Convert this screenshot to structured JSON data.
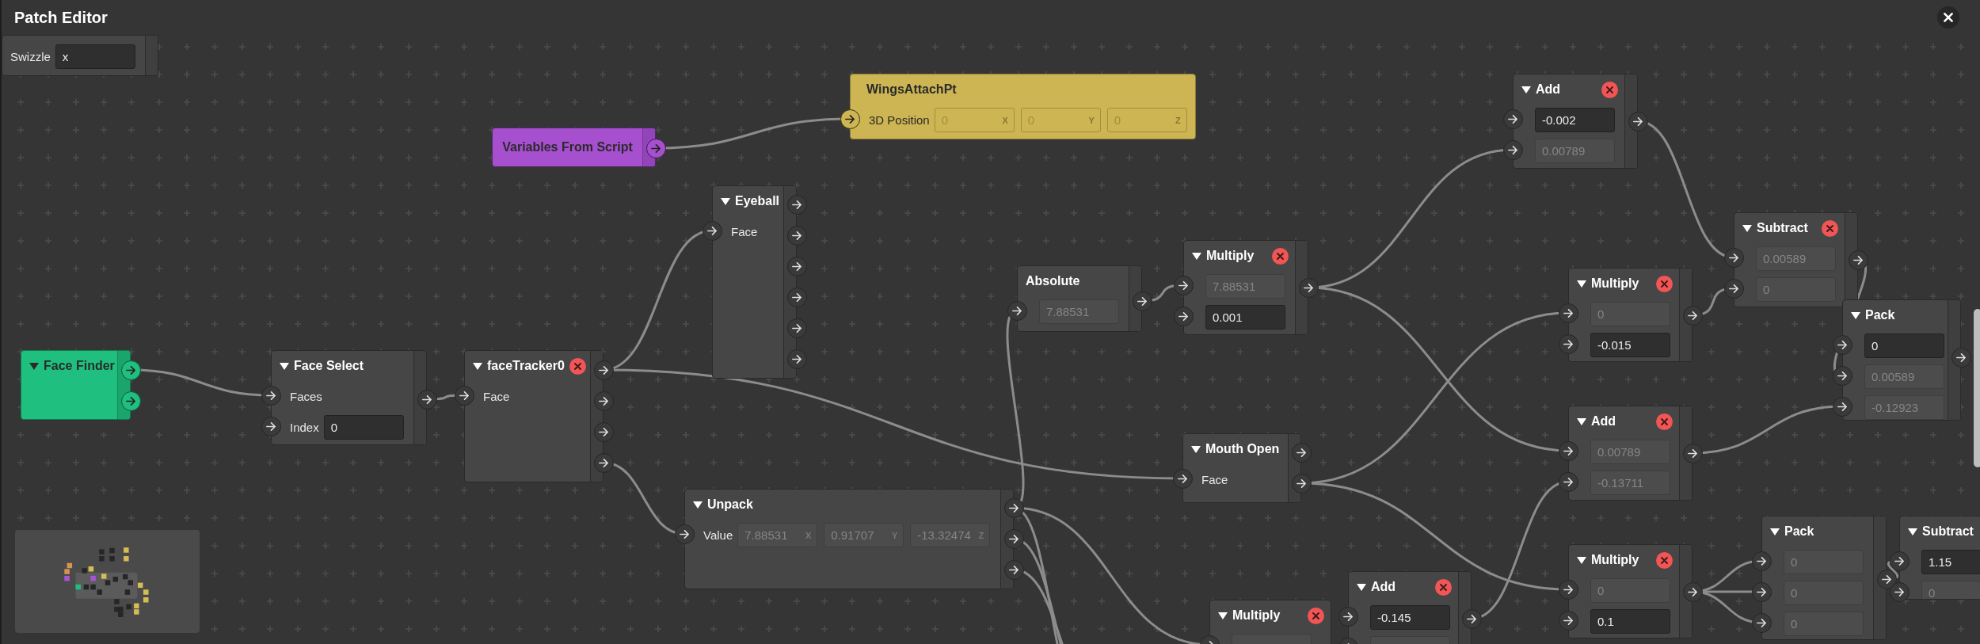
{
  "window": {
    "title": "Patch Editor"
  },
  "nodes": [
    {
      "kind": "patch",
      "rows": [
        {
          "label": "Swizzle",
          "has_port": false,
          "fields": [
            {
              "value": "x",
              "disabled": false
            }
          ]
        }
      ]
    },
    {
      "kind": "script",
      "title": "Variables From Script",
      "outputs": [
        {
          "kind": "arrow"
        }
      ]
    },
    {
      "kind": "object",
      "title": "WingsAttachPt",
      "rows": [
        {
          "label": "3D Position",
          "has_port": true,
          "fields": [
            {
              "value": "0",
              "axis": "X",
              "disabled": true
            },
            {
              "value": "0",
              "axis": "Y",
              "disabled": true
            },
            {
              "value": "0",
              "axis": "Z",
              "disabled": true
            }
          ]
        }
      ]
    },
    {
      "kind": "patch",
      "title": "Add",
      "expanded": true,
      "removable": true,
      "rows": [
        {
          "has_port": true,
          "fields": [
            {
              "value": "-0.002",
              "disabled": false
            }
          ]
        },
        {
          "has_port": true,
          "fields": [
            {
              "value": "0.00789",
              "disabled": true
            }
          ]
        }
      ],
      "outputs": [
        {
          "kind": "arrow"
        }
      ]
    },
    {
      "kind": "producer",
      "title": "Face Finder",
      "expanded": true,
      "outputs": [
        {
          "kind": "arrow"
        },
        {
          "kind": "arrow"
        }
      ]
    },
    {
      "kind": "patch",
      "title": "Face Select",
      "expanded": true,
      "rows": [
        {
          "label": "Faces",
          "has_port": true
        },
        {
          "label": "Index",
          "has_port": true,
          "fields": [
            {
              "value": "0",
              "disabled": false
            }
          ]
        }
      ],
      "outputs": [
        {
          "kind": "arrow"
        }
      ]
    },
    {
      "kind": "patch",
      "title": "faceTracker0",
      "expanded": true,
      "removable": true,
      "rows": [
        {
          "label": "Face",
          "has_port": true
        }
      ],
      "outputs": [
        {
          "kind": "arrow"
        },
        {
          "kind": "arrow"
        },
        {
          "kind": "arrow"
        },
        {
          "kind": "arrow"
        }
      ]
    },
    {
      "kind": "patch",
      "title": "Eyeball",
      "expanded": true,
      "rows": [
        {
          "label": "Face",
          "has_port": true
        }
      ],
      "outputs": [
        {
          "kind": "arrow"
        },
        {
          "kind": "arrow"
        },
        {
          "kind": "arrow"
        },
        {
          "kind": "arrow"
        },
        {
          "kind": "arrow"
        },
        {
          "kind": "arrow"
        }
      ]
    },
    {
      "kind": "patch",
      "title": "Absolute",
      "rows": [
        {
          "has_port": true,
          "fields": [
            {
              "value": "7.88531",
              "disabled": true
            }
          ]
        }
      ],
      "outputs": [
        {
          "kind": "arrow"
        }
      ]
    },
    {
      "kind": "patch",
      "title": "Multiply",
      "expanded": true,
      "removable": true,
      "rows": [
        {
          "has_port": true,
          "fields": [
            {
              "value": "7.88531",
              "disabled": true
            }
          ]
        },
        {
          "has_port": true,
          "fields": [
            {
              "value": "0.001",
              "disabled": false
            }
          ]
        }
      ],
      "outputs": [
        {
          "kind": "arrow"
        }
      ]
    },
    {
      "kind": "patch",
      "title": "Mouth Open",
      "expanded": true,
      "rows": [
        {
          "label": "Face",
          "has_port": true
        }
      ],
      "outputs": [
        {
          "kind": "arrow"
        },
        {
          "kind": "arrow"
        }
      ]
    },
    {
      "kind": "patch",
      "title": "Multiply",
      "expanded": true,
      "removable": true,
      "rows": [
        {
          "has_port": true,
          "fields": [
            {
              "value": "0",
              "disabled": true
            }
          ]
        },
        {
          "has_port": true,
          "fields": [
            {
              "value": "-0.015",
              "disabled": false
            }
          ]
        }
      ],
      "outputs": [
        {
          "kind": "arrow"
        }
      ]
    },
    {
      "kind": "patch",
      "title": "Add",
      "expanded": true,
      "removable": true,
      "rows": [
        {
          "has_port": true,
          "fields": [
            {
              "value": "0.00789",
              "disabled": true
            }
          ]
        },
        {
          "has_port": true,
          "fields": [
            {
              "value": "-0.13711",
              "disabled": true
            }
          ]
        }
      ],
      "outputs": [
        {
          "kind": "arrow"
        }
      ]
    },
    {
      "kind": "patch",
      "title": "Subtract",
      "expanded": true,
      "removable": true,
      "rows": [
        {
          "has_port": true,
          "fields": [
            {
              "value": "0.00589",
              "disabled": true
            }
          ]
        },
        {
          "has_port": true,
          "fields": [
            {
              "value": "0",
              "disabled": true
            }
          ]
        }
      ],
      "outputs": [
        {
          "kind": "arrow"
        }
      ]
    },
    {
      "kind": "patch",
      "title": "Pack",
      "expanded": true,
      "rows": [
        {
          "has_port": true,
          "fields": [
            {
              "value": "0",
              "disabled": false
            }
          ]
        },
        {
          "has_port": true,
          "fields": [
            {
              "value": "0.00589",
              "disabled": true
            }
          ]
        },
        {
          "has_port": true,
          "fields": [
            {
              "value": "-0.12923",
              "disabled": true
            }
          ]
        }
      ],
      "outputs": [
        {
          "kind": "arrow"
        }
      ]
    },
    {
      "kind": "patch",
      "title": "Unpack",
      "expanded": true,
      "rows": [
        {
          "label": "Value",
          "has_port": true,
          "fields": [
            {
              "value": "7.88531",
              "axis": "X",
              "disabled": true
            },
            {
              "value": "0.91707",
              "axis": "Y",
              "disabled": true
            },
            {
              "value": "-13.32474",
              "axis": "Z",
              "disabled": true
            }
          ]
        }
      ],
      "outputs": [
        {
          "kind": "arrow"
        },
        {
          "kind": "arrow"
        },
        {
          "kind": "arrow"
        }
      ]
    },
    {
      "kind": "patch",
      "title": "Multiply",
      "expanded": true,
      "removable": true,
      "rows": [
        {
          "has_port": true,
          "fields": [
            {
              "disabled": true
            }
          ]
        }
      ]
    },
    {
      "kind": "patch",
      "title": "Add",
      "expanded": true,
      "removable": true,
      "rows": [
        {
          "has_port": true,
          "fields": [
            {
              "value": "-0.145",
              "disabled": false
            }
          ]
        },
        {
          "has_port": true,
          "fields": [
            {
              "disabled": true
            }
          ]
        }
      ],
      "outputs": [
        {
          "kind": "arrow"
        }
      ]
    },
    {
      "kind": "patch",
      "title": "Multiply",
      "expanded": true,
      "removable": true,
      "rows": [
        {
          "has_port": true,
          "fields": [
            {
              "value": "0",
              "disabled": true
            }
          ]
        },
        {
          "has_port": true,
          "fields": [
            {
              "value": "0.1",
              "disabled": false
            }
          ]
        }
      ],
      "outputs": [
        {
          "kind": "arrow"
        }
      ]
    },
    {
      "kind": "patch",
      "title": "Pack",
      "expanded": true,
      "rows": [
        {
          "has_port": true,
          "fields": [
            {
              "value": "0",
              "disabled": true
            }
          ]
        },
        {
          "has_port": true,
          "fields": [
            {
              "value": "0",
              "disabled": true
            }
          ]
        },
        {
          "has_port": true,
          "fields": [
            {
              "value": "0",
              "disabled": true
            }
          ]
        }
      ],
      "outputs": [
        {
          "kind": "arrow"
        }
      ]
    },
    {
      "kind": "patch",
      "title": "Subtract",
      "expanded": true,
      "rows": [
        {
          "has_port": true,
          "fields": [
            {
              "value": "1.15",
              "disabled": false
            }
          ]
        },
        {
          "has_port": true,
          "fields": [
            {
              "value": "0",
              "disabled": true
            }
          ]
        }
      ]
    }
  ]
}
